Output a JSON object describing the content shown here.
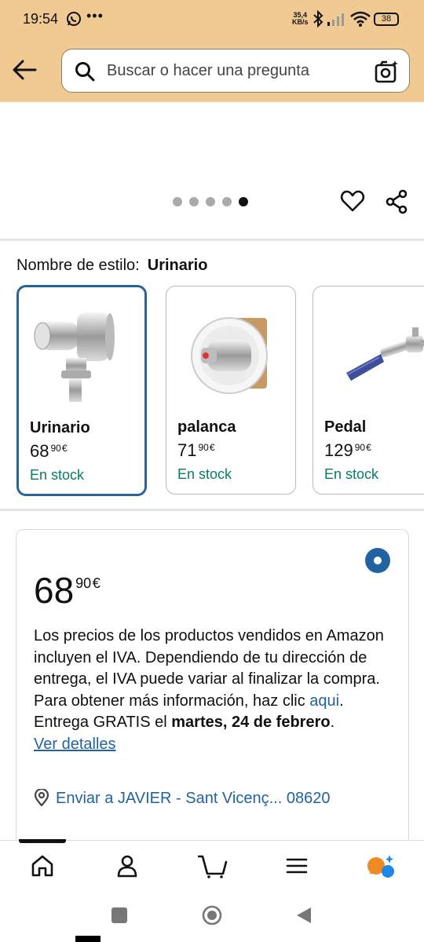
{
  "status": {
    "time": "19:54",
    "more": "•••",
    "net_speed": "35,4",
    "net_unit": "KB/s",
    "battery": "38"
  },
  "search": {
    "placeholder": "Buscar o hacer una pregunta"
  },
  "carousel": {
    "dot_count": 5,
    "active_index": 4
  },
  "style_selector": {
    "label": "Nombre de estilo:",
    "selected": "Urinario",
    "options": [
      {
        "name": "Urinario",
        "price_whole": "68",
        "price_fraction": "90",
        "currency": "€",
        "stock": "En stock"
      },
      {
        "name": "palanca",
        "price_whole": "71",
        "price_fraction": "90",
        "currency": "€",
        "stock": "En stock"
      },
      {
        "name": "Pedal",
        "price_whole": "129",
        "price_fraction": "90",
        "currency": "€",
        "stock": "En stock"
      }
    ]
  },
  "buybox": {
    "price_whole": "68",
    "price_fraction": "90",
    "currency": "€",
    "vat_text": "Los precios de los productos vendidos en Amazon incluyen el IVA. Dependiendo de tu dirección de entrega, el IVA puede variar al finalizar la compra. Para obtener más información, haz clic ",
    "vat_link": "aqui",
    "vat_end": ".",
    "delivery_prefix": "Entrega GRATIS el ",
    "delivery_date": "martes, 24 de febrero",
    "delivery_end": ".",
    "details_link": "Ver detalles",
    "ship_to": "Enviar a JAVIER - Sant Vicenç... 08620"
  },
  "colors": {
    "header_bg": "#f0c993",
    "link": "#2162a1",
    "stock": "#067d62",
    "selected_border": "#2a6496"
  }
}
